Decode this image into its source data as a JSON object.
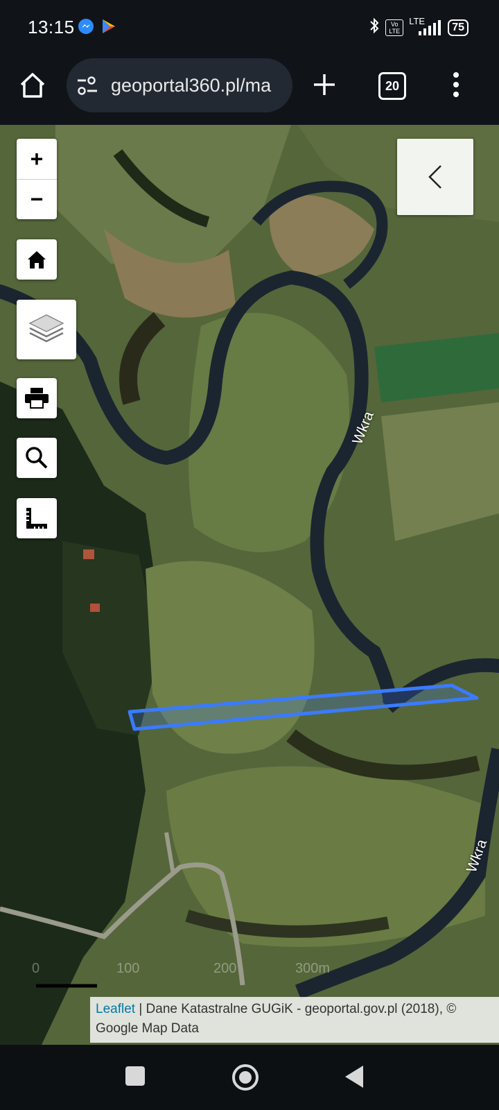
{
  "status": {
    "time": "13:15",
    "network": "LTE",
    "volte": "Vo LTE",
    "battery": "75"
  },
  "browser": {
    "url": "geoportal360.pl/ma",
    "tab_count": "20"
  },
  "map": {
    "zoom_in": "+",
    "zoom_out": "−",
    "river_label_1": "Wkra",
    "river_label_2": "Wkra",
    "scale": {
      "labels": [
        "0",
        "100",
        "200",
        "300m"
      ]
    },
    "attribution": {
      "leaflet": "Leaflet",
      "text": " | Dane Katastralne GUGiK - geoportal.gov.pl (2018), © Google Map Data"
    }
  },
  "colors": {
    "parcel_outline": "#3a7bff",
    "river": "#1b2530"
  }
}
